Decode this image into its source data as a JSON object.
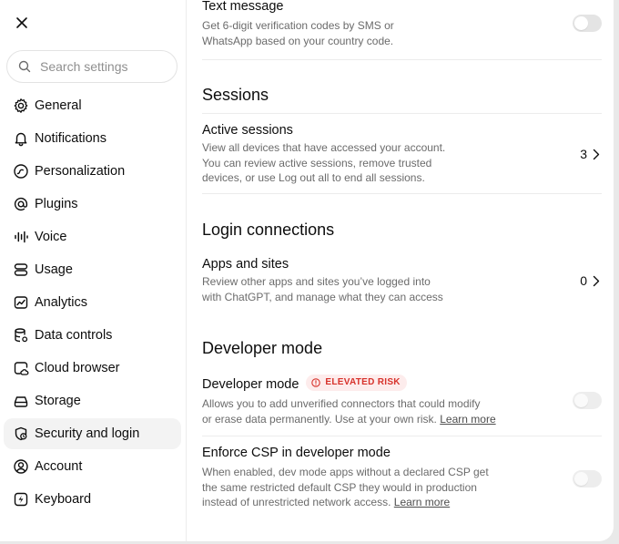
{
  "search": {
    "placeholder": "Search settings"
  },
  "sidebar": {
    "items": [
      {
        "label": "General",
        "icon": "gear-icon"
      },
      {
        "label": "Notifications",
        "icon": "bell-icon"
      },
      {
        "label": "Personalization",
        "icon": "personalization-icon"
      },
      {
        "label": "Plugins",
        "icon": "at-sign-icon"
      },
      {
        "label": "Voice",
        "icon": "waveform-icon"
      },
      {
        "label": "Usage",
        "icon": "usage-icon"
      },
      {
        "label": "Analytics",
        "icon": "analytics-icon"
      },
      {
        "label": "Data controls",
        "icon": "database-icon"
      },
      {
        "label": "Cloud browser",
        "icon": "cloud-browser-icon"
      },
      {
        "label": "Storage",
        "icon": "storage-icon"
      },
      {
        "label": "Security and login",
        "icon": "security-icon",
        "active": true
      },
      {
        "label": "Account",
        "icon": "account-icon"
      },
      {
        "label": "Keyboard",
        "icon": "keyboard-icon"
      }
    ]
  },
  "text_message": {
    "title": "Text message",
    "desc_line1": "Get 6-digit verification codes by SMS or",
    "desc_line2": "WhatsApp based on your country code.",
    "enabled": false
  },
  "sessions": {
    "heading": "Sessions",
    "active": {
      "title": "Active sessions",
      "desc_line1": "View all devices that have accessed your account.",
      "desc_line2": "You can review active sessions, remove trusted",
      "desc_line3": "devices, or use Log out all to end all sessions.",
      "count": "3"
    }
  },
  "login_connections": {
    "heading": "Login connections",
    "apps": {
      "title": "Apps and sites",
      "desc_line1": "Review other apps and sites you’ve logged into",
      "desc_line2": "with ChatGPT, and manage what they can access",
      "count": "0"
    }
  },
  "developer": {
    "heading": "Developer mode",
    "mode": {
      "title": "Developer mode",
      "badge": "ELEVATED RISK",
      "desc_line1": "Allows you to add unverified connectors that could modify",
      "desc_line2": "or erase data permanently. Use at your own risk.",
      "learn_more": "Learn more",
      "enabled": false
    },
    "csp": {
      "title": "Enforce CSP in developer mode",
      "desc_line1": "When enabled, dev mode apps without a declared CSP get",
      "desc_line2": "the same restricted default CSP they would in production",
      "desc_line3": "instead of unrestricted network access.",
      "learn_more": "Learn more",
      "enabled": false
    }
  },
  "colors": {
    "accent_danger": "#d7322b",
    "badge_bg": "#fdecec",
    "active_nav_bg": "#f3f3f3"
  }
}
